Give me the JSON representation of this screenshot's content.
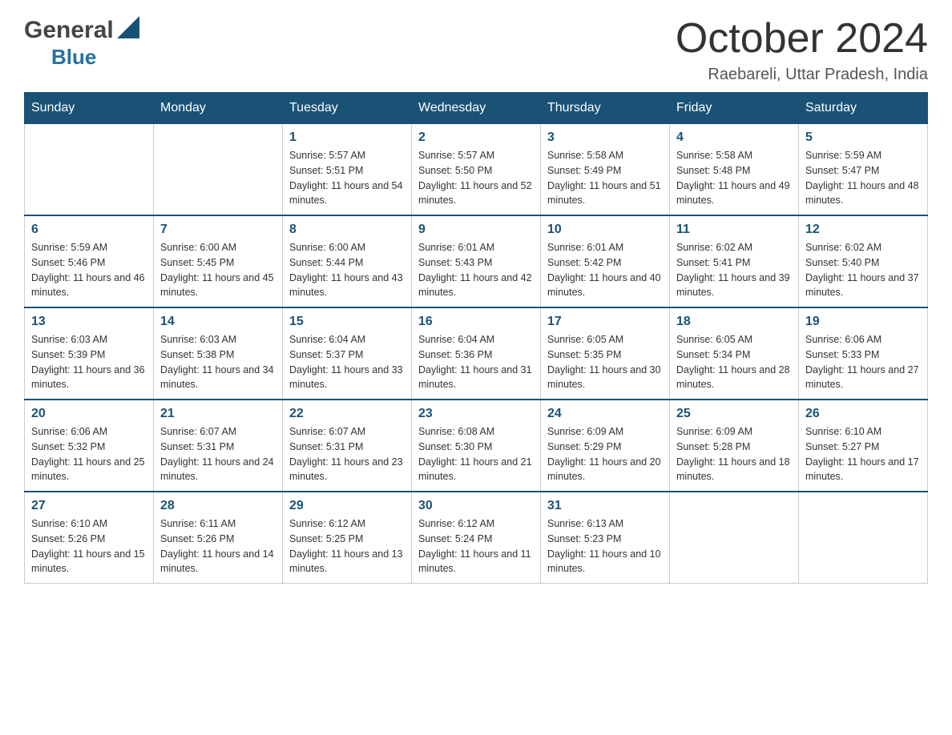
{
  "logo": {
    "general": "General",
    "blue": "Blue"
  },
  "header": {
    "month_year": "October 2024",
    "location": "Raebareli, Uttar Pradesh, India"
  },
  "columns": [
    "Sunday",
    "Monday",
    "Tuesday",
    "Wednesday",
    "Thursday",
    "Friday",
    "Saturday"
  ],
  "weeks": [
    [
      {
        "day": "",
        "sunrise": "",
        "sunset": "",
        "daylight": ""
      },
      {
        "day": "",
        "sunrise": "",
        "sunset": "",
        "daylight": ""
      },
      {
        "day": "1",
        "sunrise": "Sunrise: 5:57 AM",
        "sunset": "Sunset: 5:51 PM",
        "daylight": "Daylight: 11 hours and 54 minutes."
      },
      {
        "day": "2",
        "sunrise": "Sunrise: 5:57 AM",
        "sunset": "Sunset: 5:50 PM",
        "daylight": "Daylight: 11 hours and 52 minutes."
      },
      {
        "day": "3",
        "sunrise": "Sunrise: 5:58 AM",
        "sunset": "Sunset: 5:49 PM",
        "daylight": "Daylight: 11 hours and 51 minutes."
      },
      {
        "day": "4",
        "sunrise": "Sunrise: 5:58 AM",
        "sunset": "Sunset: 5:48 PM",
        "daylight": "Daylight: 11 hours and 49 minutes."
      },
      {
        "day": "5",
        "sunrise": "Sunrise: 5:59 AM",
        "sunset": "Sunset: 5:47 PM",
        "daylight": "Daylight: 11 hours and 48 minutes."
      }
    ],
    [
      {
        "day": "6",
        "sunrise": "Sunrise: 5:59 AM",
        "sunset": "Sunset: 5:46 PM",
        "daylight": "Daylight: 11 hours and 46 minutes."
      },
      {
        "day": "7",
        "sunrise": "Sunrise: 6:00 AM",
        "sunset": "Sunset: 5:45 PM",
        "daylight": "Daylight: 11 hours and 45 minutes."
      },
      {
        "day": "8",
        "sunrise": "Sunrise: 6:00 AM",
        "sunset": "Sunset: 5:44 PM",
        "daylight": "Daylight: 11 hours and 43 minutes."
      },
      {
        "day": "9",
        "sunrise": "Sunrise: 6:01 AM",
        "sunset": "Sunset: 5:43 PM",
        "daylight": "Daylight: 11 hours and 42 minutes."
      },
      {
        "day": "10",
        "sunrise": "Sunrise: 6:01 AM",
        "sunset": "Sunset: 5:42 PM",
        "daylight": "Daylight: 11 hours and 40 minutes."
      },
      {
        "day": "11",
        "sunrise": "Sunrise: 6:02 AM",
        "sunset": "Sunset: 5:41 PM",
        "daylight": "Daylight: 11 hours and 39 minutes."
      },
      {
        "day": "12",
        "sunrise": "Sunrise: 6:02 AM",
        "sunset": "Sunset: 5:40 PM",
        "daylight": "Daylight: 11 hours and 37 minutes."
      }
    ],
    [
      {
        "day": "13",
        "sunrise": "Sunrise: 6:03 AM",
        "sunset": "Sunset: 5:39 PM",
        "daylight": "Daylight: 11 hours and 36 minutes."
      },
      {
        "day": "14",
        "sunrise": "Sunrise: 6:03 AM",
        "sunset": "Sunset: 5:38 PM",
        "daylight": "Daylight: 11 hours and 34 minutes."
      },
      {
        "day": "15",
        "sunrise": "Sunrise: 6:04 AM",
        "sunset": "Sunset: 5:37 PM",
        "daylight": "Daylight: 11 hours and 33 minutes."
      },
      {
        "day": "16",
        "sunrise": "Sunrise: 6:04 AM",
        "sunset": "Sunset: 5:36 PM",
        "daylight": "Daylight: 11 hours and 31 minutes."
      },
      {
        "day": "17",
        "sunrise": "Sunrise: 6:05 AM",
        "sunset": "Sunset: 5:35 PM",
        "daylight": "Daylight: 11 hours and 30 minutes."
      },
      {
        "day": "18",
        "sunrise": "Sunrise: 6:05 AM",
        "sunset": "Sunset: 5:34 PM",
        "daylight": "Daylight: 11 hours and 28 minutes."
      },
      {
        "day": "19",
        "sunrise": "Sunrise: 6:06 AM",
        "sunset": "Sunset: 5:33 PM",
        "daylight": "Daylight: 11 hours and 27 minutes."
      }
    ],
    [
      {
        "day": "20",
        "sunrise": "Sunrise: 6:06 AM",
        "sunset": "Sunset: 5:32 PM",
        "daylight": "Daylight: 11 hours and 25 minutes."
      },
      {
        "day": "21",
        "sunrise": "Sunrise: 6:07 AM",
        "sunset": "Sunset: 5:31 PM",
        "daylight": "Daylight: 11 hours and 24 minutes."
      },
      {
        "day": "22",
        "sunrise": "Sunrise: 6:07 AM",
        "sunset": "Sunset: 5:31 PM",
        "daylight": "Daylight: 11 hours and 23 minutes."
      },
      {
        "day": "23",
        "sunrise": "Sunrise: 6:08 AM",
        "sunset": "Sunset: 5:30 PM",
        "daylight": "Daylight: 11 hours and 21 minutes."
      },
      {
        "day": "24",
        "sunrise": "Sunrise: 6:09 AM",
        "sunset": "Sunset: 5:29 PM",
        "daylight": "Daylight: 11 hours and 20 minutes."
      },
      {
        "day": "25",
        "sunrise": "Sunrise: 6:09 AM",
        "sunset": "Sunset: 5:28 PM",
        "daylight": "Daylight: 11 hours and 18 minutes."
      },
      {
        "day": "26",
        "sunrise": "Sunrise: 6:10 AM",
        "sunset": "Sunset: 5:27 PM",
        "daylight": "Daylight: 11 hours and 17 minutes."
      }
    ],
    [
      {
        "day": "27",
        "sunrise": "Sunrise: 6:10 AM",
        "sunset": "Sunset: 5:26 PM",
        "daylight": "Daylight: 11 hours and 15 minutes."
      },
      {
        "day": "28",
        "sunrise": "Sunrise: 6:11 AM",
        "sunset": "Sunset: 5:26 PM",
        "daylight": "Daylight: 11 hours and 14 minutes."
      },
      {
        "day": "29",
        "sunrise": "Sunrise: 6:12 AM",
        "sunset": "Sunset: 5:25 PM",
        "daylight": "Daylight: 11 hours and 13 minutes."
      },
      {
        "day": "30",
        "sunrise": "Sunrise: 6:12 AM",
        "sunset": "Sunset: 5:24 PM",
        "daylight": "Daylight: 11 hours and 11 minutes."
      },
      {
        "day": "31",
        "sunrise": "Sunrise: 6:13 AM",
        "sunset": "Sunset: 5:23 PM",
        "daylight": "Daylight: 11 hours and 10 minutes."
      },
      {
        "day": "",
        "sunrise": "",
        "sunset": "",
        "daylight": ""
      },
      {
        "day": "",
        "sunrise": "",
        "sunset": "",
        "daylight": ""
      }
    ]
  ]
}
